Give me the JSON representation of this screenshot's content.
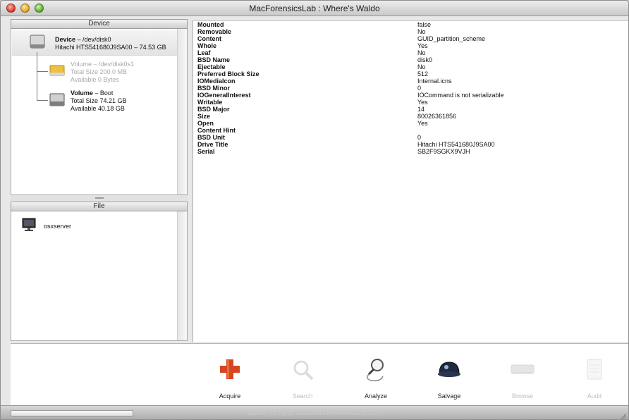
{
  "window": {
    "title": "MacForensicsLab : Where's Waldo"
  },
  "device_pane": {
    "header": "Device",
    "device": {
      "line1_name": "Device",
      "line1_rest": " – /dev/disk0",
      "line2": "Hitachi HTS541680J9SA00 – 74.53 GB"
    },
    "volume1": {
      "line1": "Volume – /dev/disk0s1",
      "line2": "Total Size 200.0 MB",
      "line3": "Available 0 Bytes"
    },
    "volume2": {
      "line1_name": "Volume",
      "line1_rest": " – Boot",
      "line2": "Total Size 74.21 GB",
      "line3": "Available 40.18 GB"
    }
  },
  "file_pane": {
    "header": "File",
    "items": [
      {
        "label": "osxserver"
      }
    ]
  },
  "details": [
    {
      "key": "Mounted",
      "value": "false"
    },
    {
      "key": "Removable",
      "value": "No"
    },
    {
      "key": "Content",
      "value": "GUID_partition_scheme"
    },
    {
      "key": "Whole",
      "value": "Yes"
    },
    {
      "key": "Leaf",
      "value": "No"
    },
    {
      "key": "BSD Name",
      "value": "disk0"
    },
    {
      "key": "Ejectable",
      "value": "No"
    },
    {
      "key": "Preferred Block Size",
      "value": "512"
    },
    {
      "key": "IOMediaIcon",
      "value": "Internal.icns"
    },
    {
      "key": "BSD Minor",
      "value": "0"
    },
    {
      "key": "IOGeneralInterest",
      "value": "IOCommand is not serializable"
    },
    {
      "key": "Writable",
      "value": "Yes"
    },
    {
      "key": "BSD Major",
      "value": "14"
    },
    {
      "key": "Size",
      "value": "80026361856"
    },
    {
      "key": "Open",
      "value": "Yes"
    },
    {
      "key": "Content Hint",
      "value": ""
    },
    {
      "key": "BSD Unit",
      "value": "0"
    },
    {
      "key": "Drive Title",
      "value": "Hitachi HTS541680J9SA00"
    },
    {
      "key": "Serial",
      "value": "SB2F9SGKX9VJH"
    }
  ],
  "toolbar": {
    "acquire": "Acquire",
    "search": "Search",
    "analyze": "Analyze",
    "salvage": "Salvage",
    "browse": "Browse",
    "audit": "Audit"
  },
  "statusbar": {
    "text": "Waiting for input, Document Preferences 1.0.0.0"
  },
  "icons": {
    "acquire": "medical-cross-icon",
    "search": "magnifier-icon",
    "analyze": "magnifier-cable-icon",
    "salvage": "helmet-icon",
    "browse": "drive-icon",
    "audit": "document-icon"
  },
  "colors": {
    "acquire_cross": "#d8461f",
    "selection": "#e6e6e6"
  }
}
